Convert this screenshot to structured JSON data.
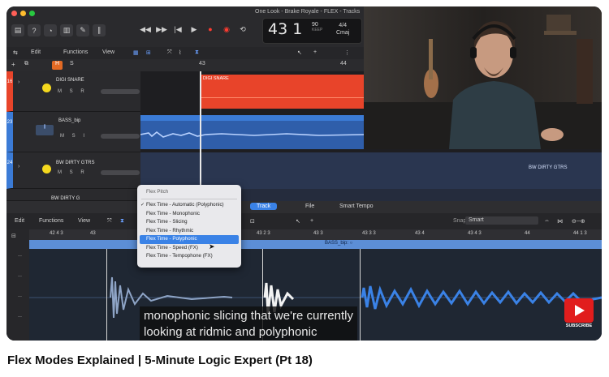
{
  "video_title": "Flex Modes Explained | 5-Minute Logic Expert (Pt 18)",
  "logic": {
    "window_title": "One Look - Brake Royale - FLEX - Tracks",
    "lcd": {
      "bar": "43",
      "beat": "1",
      "tempo": "90",
      "tempo_label": "KEEP",
      "sig": "4/4",
      "key": "Cmaj"
    },
    "menu": {
      "edit": "Edit",
      "functions": "Functions",
      "view": "View"
    },
    "ruler_top": [
      "43",
      "44"
    ],
    "tracks": [
      {
        "number": "16",
        "name": "DIGI SNARE",
        "controls": "M S R",
        "region_label": "DIGI SNARE",
        "color": "#e8442a"
      },
      {
        "number": "23",
        "name": "BASS_bip",
        "controls": "M S I",
        "region_label": "",
        "color": "#3b7bd6"
      },
      {
        "number": "24",
        "name": "BW DIRTY GTRS",
        "controls": "M S R",
        "region_label": "BW DIRTY GTRS",
        "color": "#2c3a52"
      },
      {
        "number": "",
        "name": "BW DIRTY G",
        "controls": "",
        "region_label": "",
        "color": "#2c3a52"
      }
    ],
    "editor": {
      "tabs": [
        "Track",
        "File",
        "Smart Tempo"
      ],
      "active_tab": "Track",
      "menu": {
        "edit": "Edit",
        "functions": "Functions",
        "view": "View"
      },
      "snap_label": "Snap:",
      "snap_value": "Smart",
      "ruler": [
        "42 4 3",
        "43",
        "43 1 3",
        "43 2",
        "43 2 3",
        "43 3",
        "43 3 3",
        "43 4",
        "43 4 3",
        "44",
        "44 1 3"
      ],
      "region_label": "BASS_bip: ○"
    },
    "flex_menu": {
      "header": "Flex Pitch",
      "items": [
        {
          "label": "Flex Time - Automatic (Polyphonic)",
          "checked": true,
          "selected": false
        },
        {
          "label": "Flex Time - Monophonic",
          "checked": false,
          "selected": false
        },
        {
          "label": "Flex Time - Slicing",
          "checked": false,
          "selected": false
        },
        {
          "label": "Flex Time - Rhythmic",
          "checked": false,
          "selected": false
        },
        {
          "label": "Flex Time - Polyphonic",
          "checked": false,
          "selected": true
        },
        {
          "label": "Flex Time - Speed (FX)",
          "checked": false,
          "selected": false
        },
        {
          "label": "Flex Time - Tempophone (FX)",
          "checked": false,
          "selected": false
        }
      ]
    }
  },
  "caption": {
    "line1": "monophonic slicing that we're currently",
    "line2": "looking at ridmic and polyphonic"
  },
  "subscribe_label": "SUBSCRIBE",
  "colors": {
    "selection": "#3a82e6",
    "snare_region": "#e8442a",
    "bass_region": "#3b7bd6",
    "subscribe_red": "#e11d1d"
  }
}
